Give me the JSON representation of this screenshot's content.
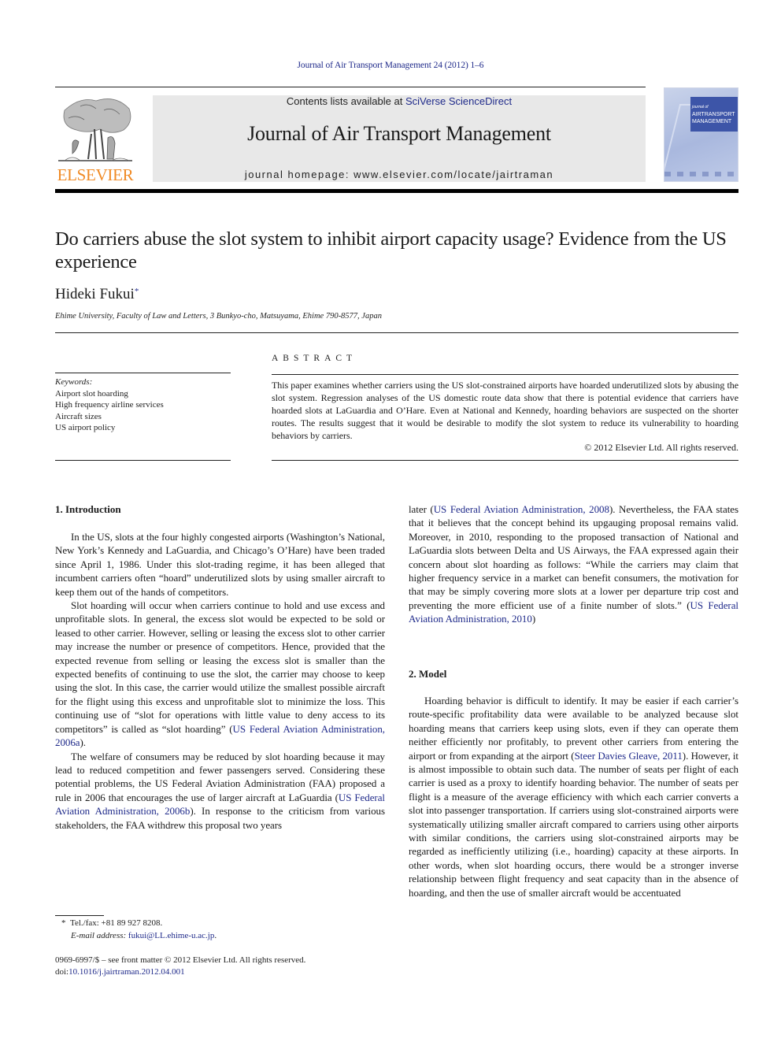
{
  "citation": "Journal of Air Transport Management 24 (2012) 1–6",
  "header": {
    "publisher_logo_text": "ELSEVIER",
    "contents_prefix": "Contents lists available at ",
    "contents_link": "SciVerse ScienceDirect",
    "journal_title": "Journal of Air Transport Management",
    "homepage": "journal homepage: www.elsevier.com/locate/jairtraman",
    "cover_title_line1": "journal of",
    "cover_title_line2": "AIRTRANSPORT",
    "cover_title_line3": "MANAGEMENT"
  },
  "article": {
    "title": "Do carriers abuse the slot system to inhibit airport capacity usage? Evidence from the US experience",
    "author": "Hideki Fukui",
    "author_mark": "*",
    "affiliation": "Ehime University, Faculty of Law and Letters, 3 Bunkyo-cho, Matsuyama, Ehime 790-8577, Japan"
  },
  "keywords": {
    "heading": "Keywords:",
    "items": [
      "Airport slot hoarding",
      "High frequency airline services",
      "Aircraft sizes",
      "US airport policy"
    ]
  },
  "abstract": {
    "heading": "ABSTRACT",
    "text": "This paper examines whether carriers using the US slot-constrained airports have hoarded underutilized slots by abusing the slot system. Regression analyses of the US domestic route data show that there is potential evidence that carriers have hoarded slots at LaGuardia and O’Hare. Even at National and Kennedy, hoarding behaviors are suspected on the shorter routes. The results suggest that it would be desirable to modify the slot system to reduce its vulnerability to hoarding behaviors by carriers.",
    "copyright": "© 2012 Elsevier Ltd. All rights reserved."
  },
  "sections": {
    "intro": {
      "heading": "1.  Introduction",
      "p1": "In the US, slots at the four highly congested airports (Washington’s National, New York’s Kennedy and LaGuardia, and Chicago’s O’Hare) have been traded since April 1, 1986. Under this slot-trading regime, it has been alleged that incumbent carriers often “hoard” underutilized slots by using smaller aircraft to keep them out of the hands of competitors.",
      "p2_text": "Slot hoarding will occur when carriers continue to hold and use excess and unprofitable slots. In general, the excess slot would be expected to be sold or leased to other carrier. However, selling or leasing the excess slot to other carrier may increase the number or presence of competitors. Hence, provided that the expected revenue from selling or leasing the excess slot is smaller than the expected benefits of continuing to use the slot, the carrier may choose to keep using the slot. In this case, the carrier would utilize the smallest possible aircraft for the flight using this excess and unprofitable slot to minimize the loss. This continuing use of “slot for operations with little value to deny access to its competitors” is called as “slot hoarding” (",
      "p2_ref": "US Federal Aviation Administration, 2006a",
      "p2_end": ").",
      "p3_text": "The welfare of consumers may be reduced by slot hoarding because it may lead to reduced competition and fewer passengers served. Considering these potential problems, the US Federal Aviation Administration (FAA) proposed a rule in 2006 that encourages the use of larger aircraft at LaGuardia (",
      "p3_ref": "US Federal Aviation Administration, 2006b",
      "p3_mid": "). In response to the criticism from various stakeholders, the FAA withdrew this proposal two years",
      "p3_cont_start": "later (",
      "p3_ref2": "US Federal Aviation Administration, 2008",
      "p3_cont": "). Nevertheless, the FAA states that it believes that the concept behind its upgauging proposal remains valid. Moreover, in 2010, responding to the proposed transaction of National and LaGuardia slots between Delta and US Airways, the FAA expressed again their concern about slot hoarding as follows: “While the carriers may claim that higher frequency service in a market can benefit consumers, the motivation for that may be simply covering more slots at a lower per departure trip cost and preventing the more efficient use of a finite number of slots.” (",
      "p3_ref3": "US Federal Aviation Administration, 2010",
      "p3_close": ")"
    },
    "model": {
      "heading": "2.  Model",
      "p1_text": "Hoarding behavior is difficult to identify. It may be easier if each carrier’s route-specific profitability data were available to be analyzed because slot hoarding means that carriers keep using slots, even if they can operate them neither efficiently nor profitably, to prevent other carriers from entering the airport or from expanding at the airport (",
      "p1_ref": "Steer Davies Gleave, 2011",
      "p1_cont": "). However, it is almost impossible to obtain such data. The number of seats per flight of each carrier is used as a proxy to identify hoarding behavior. The number of seats per flight is a measure of the average efficiency with which each carrier converts a slot into passenger transportation. If carriers using slot-constrained airports were systematically utilizing smaller aircraft compared to carriers using other airports with similar conditions, the carriers using slot-constrained airports may be regarded as inefficiently utilizing (i.e., hoarding) capacity at these airports. In other words, when slot hoarding occurs, there would be a stronger inverse relationship between flight frequency and seat capacity than in the absence of hoarding, and then the use of smaller aircraft would be accentuated"
    }
  },
  "footnote": {
    "mark": "*",
    "tel": "Tel./fax: +81 89 927 8208.",
    "email_label": "E-mail address:",
    "email": "fukui@LL.ehime-u.ac.jp",
    "email_end": "."
  },
  "frontmatter": {
    "line1": "0969-6997/$ – see front matter © 2012 Elsevier Ltd. All rights reserved.",
    "doi_label": "doi:",
    "doi": "10.1016/j.jairtraman.2012.04.001"
  },
  "colors": {
    "link": "#1f2a8a",
    "elsevier_orange": "#f08a24",
    "banner_bg": "#e8e8e8",
    "cover_blue": "#3d55a8"
  }
}
